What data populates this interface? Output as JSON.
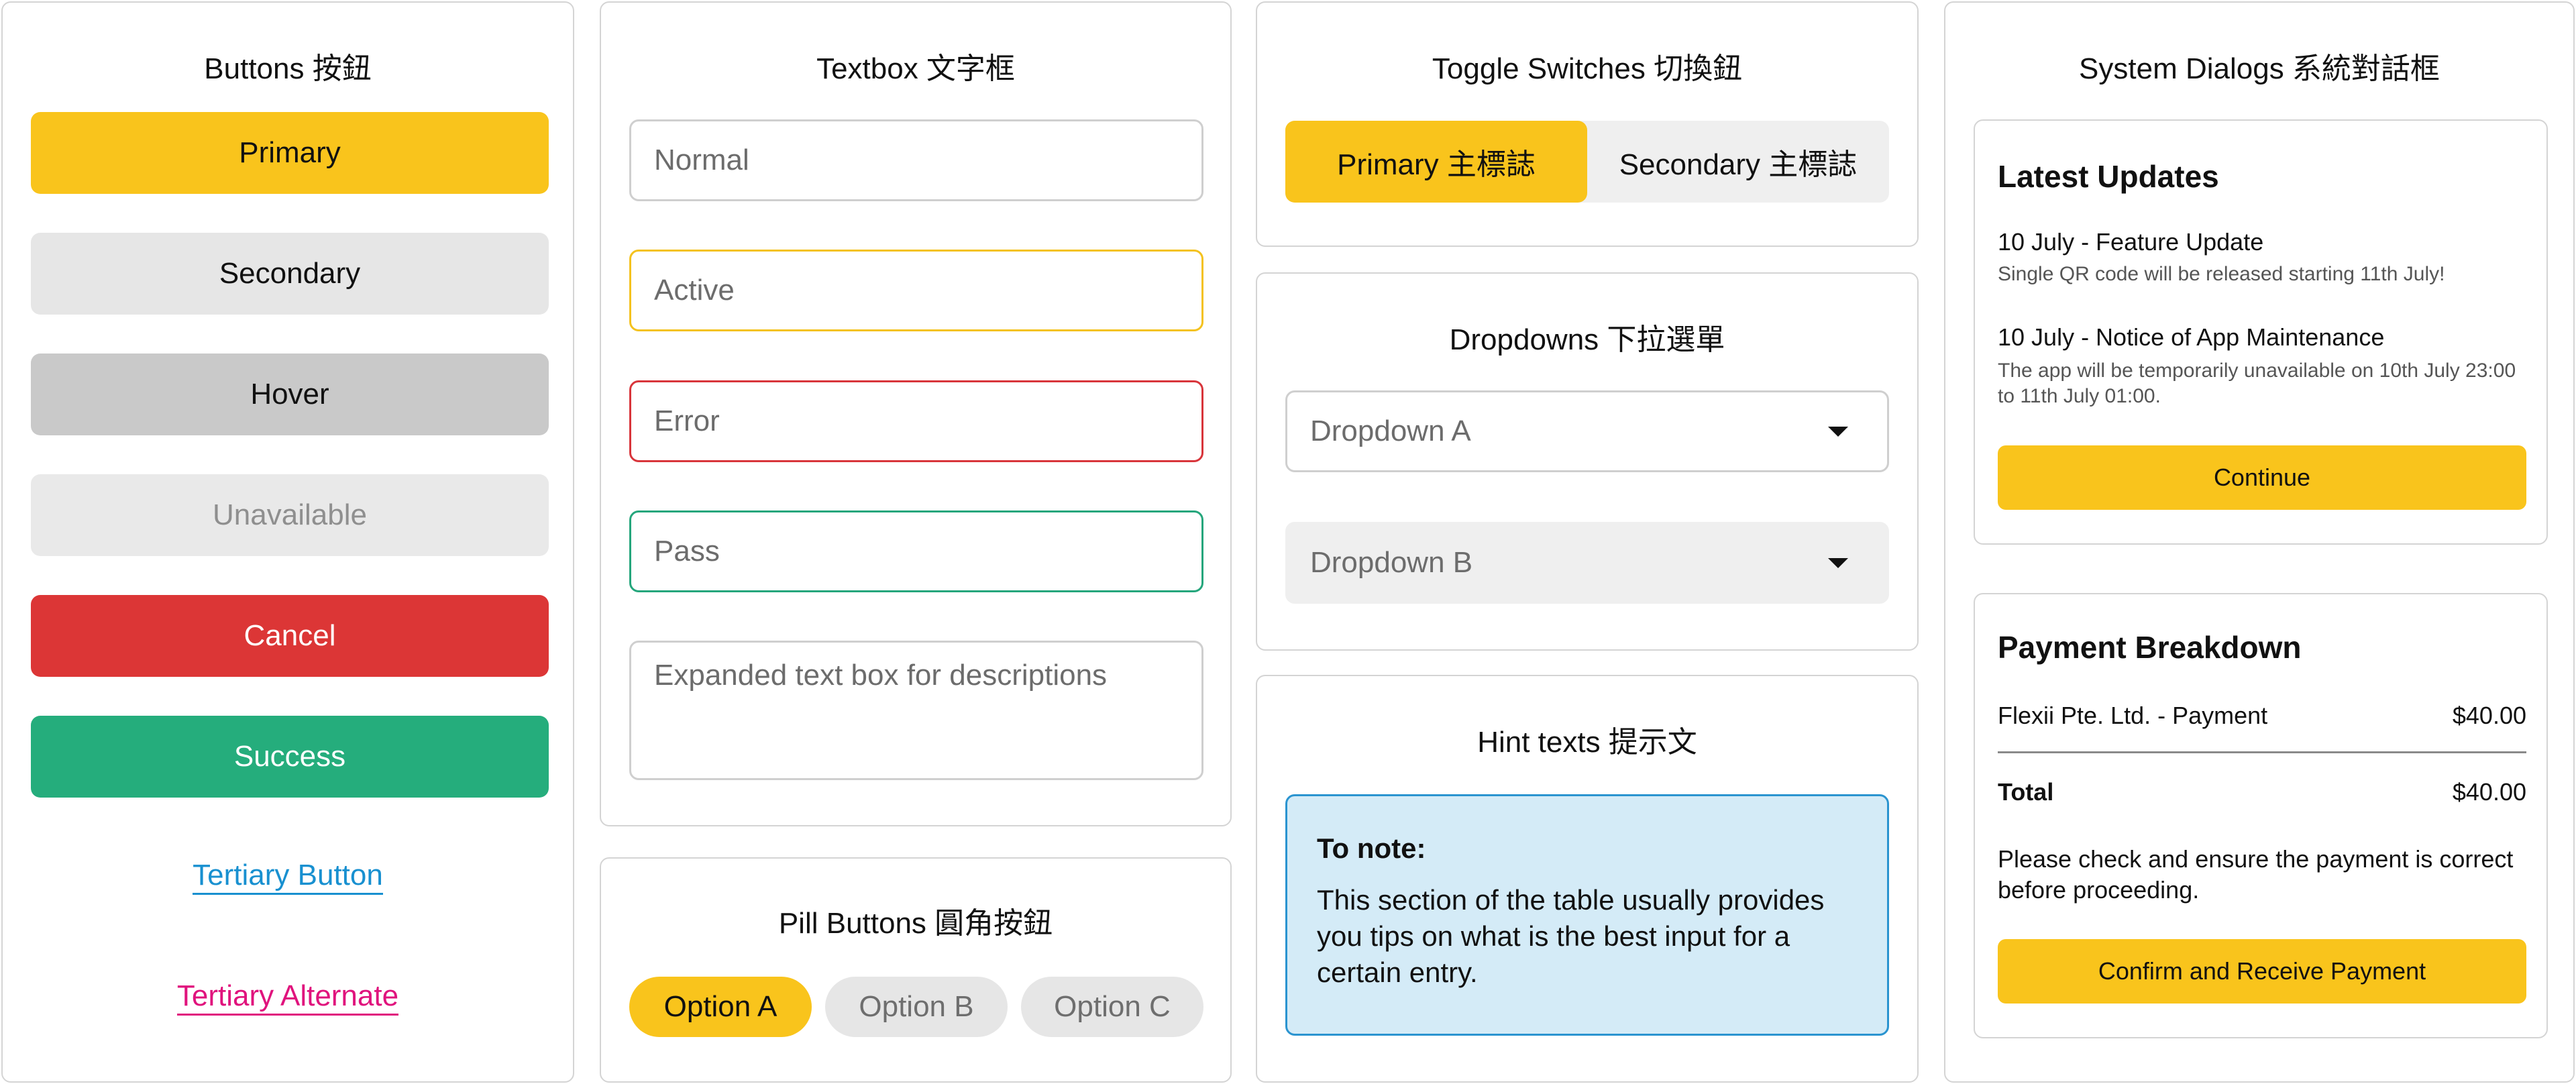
{
  "buttons": {
    "title": "Buttons 按鈕",
    "primary": "Primary",
    "secondary": "Secondary",
    "hover": "Hover",
    "unavailable": "Unavailable",
    "cancel": "Cancel",
    "success": "Success",
    "tertiary": "Tertiary Button",
    "tertiary_alt": "Tertiary Alternate"
  },
  "textbox": {
    "title": "Textbox 文字框",
    "normal": "Normal",
    "active": "Active",
    "error": "Error",
    "pass": "Pass",
    "expanded": "Expanded text box for descriptions"
  },
  "pills": {
    "title": "Pill Buttons 圓角按鈕",
    "options": [
      "Option A",
      "Option B",
      "Option C"
    ],
    "selected": "Option A"
  },
  "toggle": {
    "title": "Toggle Switches 切換鈕",
    "primary": "Primary 主標誌",
    "secondary": "Secondary 主標誌",
    "selected": "primary"
  },
  "dropdowns": {
    "title": "Dropdowns 下拉選單",
    "a": "Dropdown A",
    "b": "Dropdown B"
  },
  "hint": {
    "title": "Hint texts 提示文",
    "note_title": "To note:",
    "note_body": "This section of the table usually provides you tips on what is the best input for a certain entry."
  },
  "dialogs": {
    "title": "System Dialogs 系統對話框",
    "updates": {
      "title": "Latest Updates",
      "items": [
        {
          "heading": "10 July - Feature Update",
          "body": "Single QR code will be released starting 11th July!"
        },
        {
          "heading": "10 July - Notice of App Maintenance",
          "body": "The app will be temporarily unavailable on 10th July 23:00 to 11th July 01:00."
        }
      ],
      "button": "Continue"
    },
    "payment": {
      "title": "Payment Breakdown",
      "line_label": "Flexii Pte. Ltd. - Payment",
      "line_amount": "$40.00",
      "total_label": "Total",
      "total_amount": "$40.00",
      "note": "Please check and ensure the payment is correct before proceeding.",
      "button": "Confirm and Receive Payment"
    }
  },
  "colors": {
    "accent": "#f9c41c",
    "cancel": "#dc3636",
    "success": "#25ad7c",
    "link": "#1890d0",
    "link_alt": "#e0137d",
    "hint_bg": "#d4ebf7",
    "hint_border": "#2a94d0"
  }
}
